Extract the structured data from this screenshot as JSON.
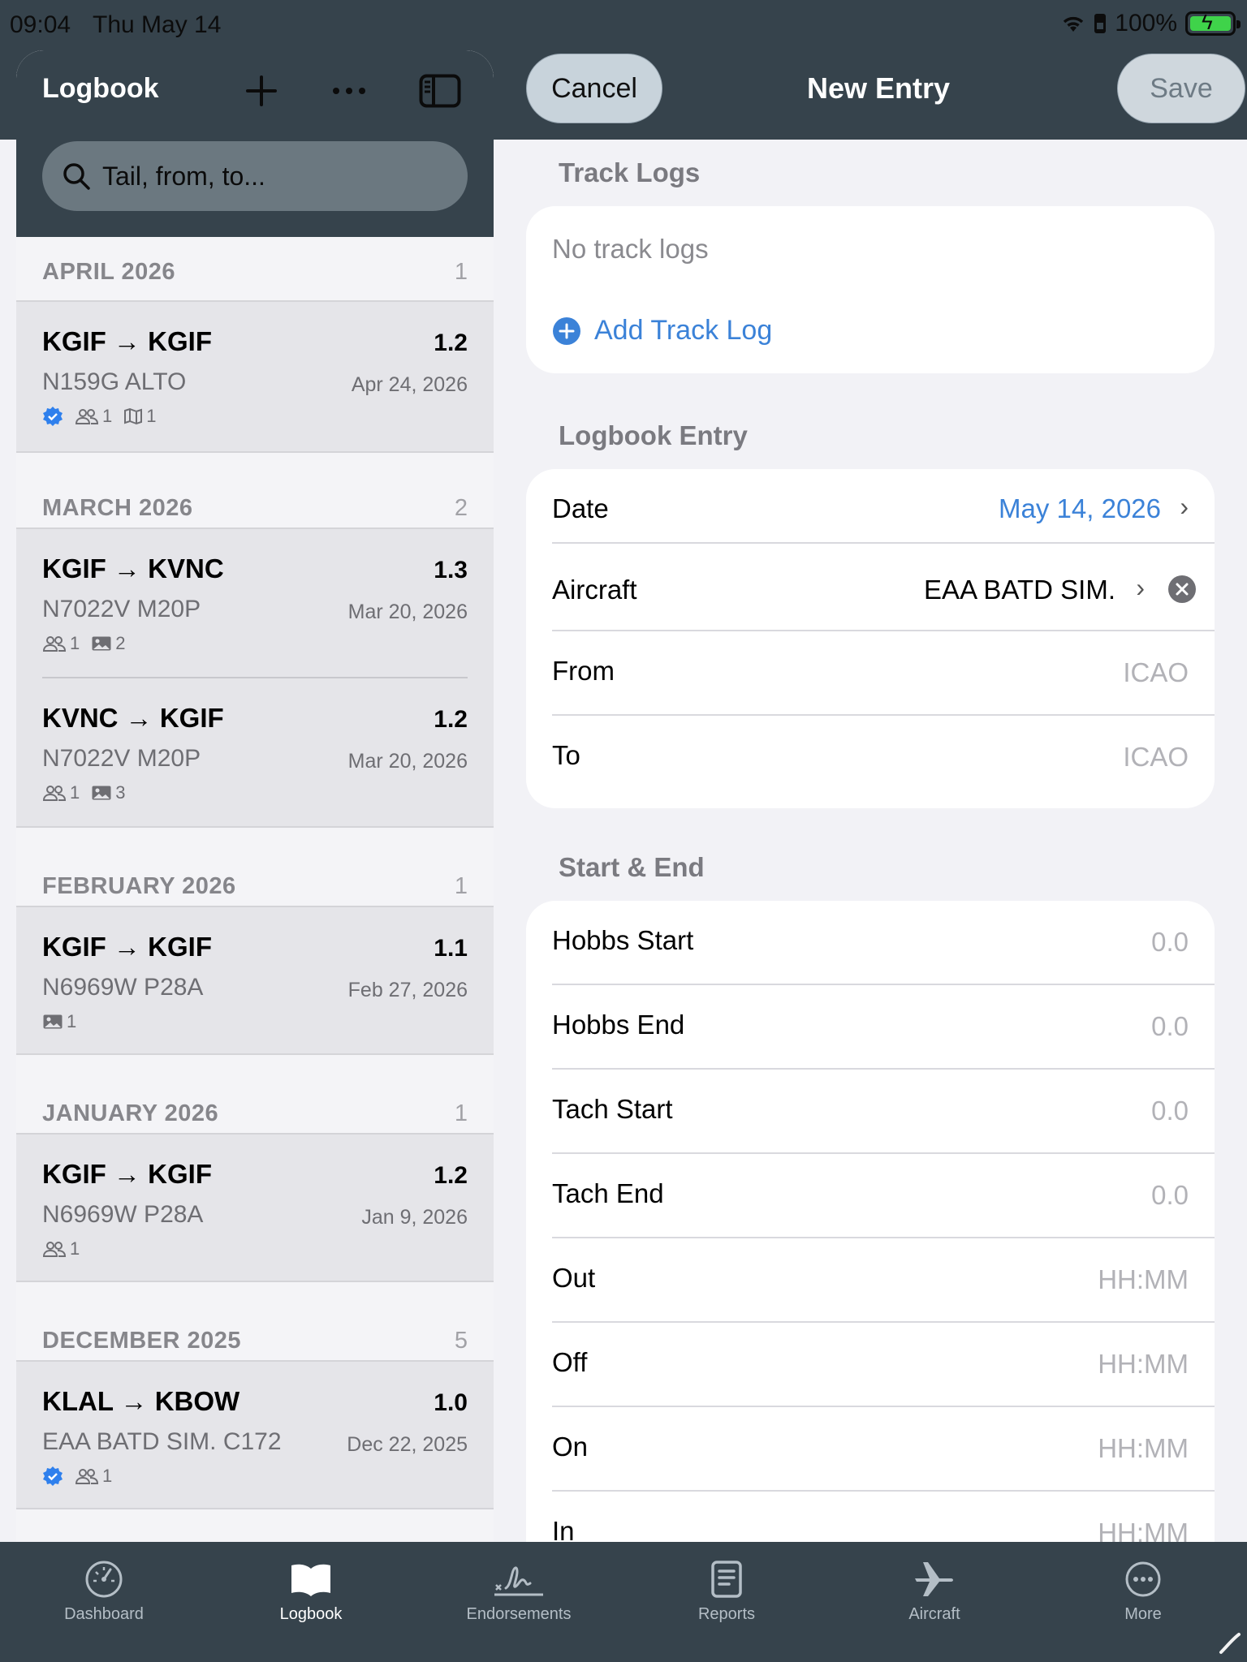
{
  "status": {
    "time": "09:04",
    "date": "Thu May 14",
    "battery": "100%"
  },
  "sidebar": {
    "title": "Logbook",
    "search_placeholder": "Tail, from, to...",
    "groups": [
      {
        "month": "APRIL 2026",
        "count": "1",
        "flights": [
          {
            "route": "KGIF → KGIF",
            "hours": "1.2",
            "tail": "N159G ALTO",
            "date": "Apr 24, 2026",
            "verified": true,
            "people": "1",
            "maps": "1"
          }
        ]
      },
      {
        "month": "MARCH 2026",
        "count": "2",
        "flights": [
          {
            "route": "KGIF → KVNC",
            "hours": "1.3",
            "tail": "N7022V M20P",
            "date": "Mar 20, 2026",
            "people": "1",
            "photos": "2"
          },
          {
            "route": "KVNC → KGIF",
            "hours": "1.2",
            "tail": "N7022V M20P",
            "date": "Mar 20, 2026",
            "people": "1",
            "photos": "3"
          }
        ]
      },
      {
        "month": "FEBRUARY 2026",
        "count": "1",
        "flights": [
          {
            "route": "KGIF → KGIF",
            "hours": "1.1",
            "tail": "N6969W P28A",
            "date": "Feb 27, 2026",
            "photos": "1"
          }
        ]
      },
      {
        "month": "JANUARY 2026",
        "count": "1",
        "flights": [
          {
            "route": "KGIF → KGIF",
            "hours": "1.2",
            "tail": "N6969W P28A",
            "date": "Jan 9, 2026",
            "people": "1"
          }
        ]
      },
      {
        "month": "DECEMBER 2025",
        "count": "5",
        "flights": [
          {
            "route": "KLAL → KBOW",
            "hours": "1.0",
            "tail": "EAA BATD SIM. C172",
            "date": "Dec 22, 2025",
            "verified": true,
            "people": "1"
          }
        ]
      }
    ]
  },
  "header": {
    "cancel": "Cancel",
    "title": "New Entry",
    "save": "Save"
  },
  "track_logs": {
    "title": "Track Logs",
    "empty": "No track logs",
    "add": "Add Track Log"
  },
  "logbook_entry": {
    "title": "Logbook Entry",
    "date_label": "Date",
    "date_value": "May 14, 2026",
    "aircraft_label": "Aircraft",
    "aircraft_value": "EAA BATD SIM.",
    "from_label": "From",
    "from_placeholder": "ICAO",
    "to_label": "To",
    "to_placeholder": "ICAO"
  },
  "start_end": {
    "title": "Start & End",
    "rows": [
      {
        "label": "Hobbs Start",
        "placeholder": "0.0"
      },
      {
        "label": "Hobbs End",
        "placeholder": "0.0"
      },
      {
        "label": "Tach Start",
        "placeholder": "0.0"
      },
      {
        "label": "Tach End",
        "placeholder": "0.0"
      },
      {
        "label": "Out",
        "placeholder": "HH:MM"
      },
      {
        "label": "Off",
        "placeholder": "HH:MM"
      },
      {
        "label": "On",
        "placeholder": "HH:MM"
      },
      {
        "label": "In",
        "placeholder": "HH:MM"
      }
    ]
  },
  "tabs": [
    {
      "label": "Dashboard",
      "icon": "gauge-icon"
    },
    {
      "label": "Logbook",
      "icon": "book-icon",
      "active": true
    },
    {
      "label": "Endorsements",
      "icon": "signature-icon"
    },
    {
      "label": "Reports",
      "icon": "document-icon"
    },
    {
      "label": "Aircraft",
      "icon": "airplane-icon"
    },
    {
      "label": "More",
      "icon": "more-icon"
    }
  ],
  "colors": {
    "bar": "#36434c",
    "accent": "#3b82d8",
    "verified": "#2f80ed"
  }
}
